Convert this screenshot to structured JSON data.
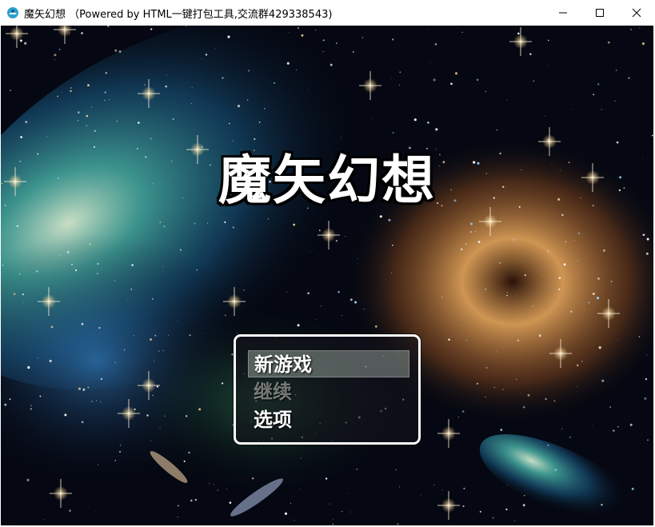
{
  "window": {
    "title": "魔矢幻想 （Powered by HTML一键打包工具,交流群429338543)",
    "controls": [
      {
        "name": "minimize-button",
        "icon": "minimize-icon",
        "glyph": "—"
      },
      {
        "name": "maximize-button",
        "icon": "maximize-icon",
        "glyph": "☐"
      },
      {
        "name": "close-button",
        "icon": "close-icon",
        "glyph": "✕"
      }
    ]
  },
  "game": {
    "logo": "魔矢幻想",
    "menu": {
      "items": [
        {
          "label": "新游戏",
          "selected": true,
          "enabled": true
        },
        {
          "label": "继续",
          "selected": false,
          "enabled": false
        },
        {
          "label": "选项",
          "selected": false,
          "enabled": true
        }
      ]
    }
  },
  "colors": {
    "space": "#050812",
    "nebula_teal": "#2aa6b0",
    "nebula_orange": "#d98a3a",
    "menu_border": "#ffffff"
  }
}
